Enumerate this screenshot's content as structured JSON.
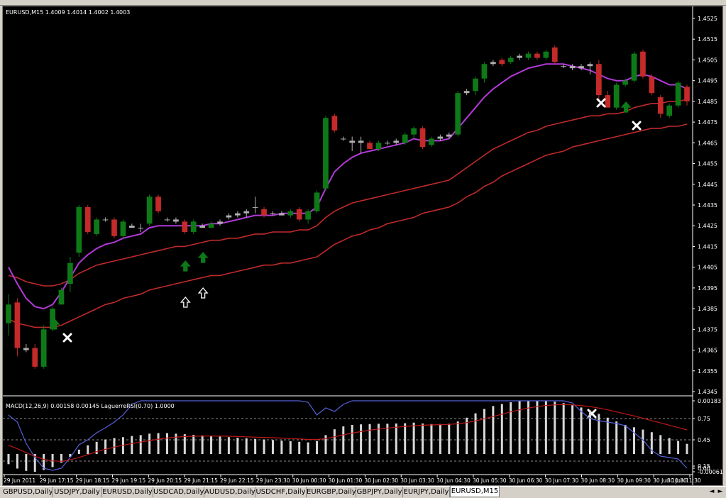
{
  "window": {
    "symbol_header": "EURUSD,M15  1.4009 1.4014 1.4002 1.4003",
    "indicator_header": "MACD(12,26,9) 0.00158 0.00145  LaguerreRSI(0.70) 1.0000"
  },
  "main_axis": {
    "labels": [
      "1.4525",
      "1.4515",
      "1.4505",
      "1.4495",
      "1.4485",
      "1.4475",
      "1.4465",
      "1.4455",
      "1.4445",
      "1.4435",
      "1.4425",
      "1.4415",
      "1.4405",
      "1.4395",
      "1.4385",
      "1.4375",
      "1.4365",
      "1.4355",
      "1.4345"
    ],
    "min": 1.4345,
    "max": 1.4525
  },
  "sub_axis": {
    "labels": [
      "0.00183",
      "0.75",
      "0.45",
      "0.00",
      "0.15",
      "-0.00061"
    ]
  },
  "time_axis": {
    "labels": [
      "29 Jun 2011",
      "29 Jun 17:15",
      "29 Jun 18:15",
      "29 Jun 19:15",
      "29 Jun 20:15",
      "29 Jun 21:15",
      "29 Jun 22:15",
      "29 Jun 23:30",
      "30 Jun 00:30",
      "30 Jun 01:30",
      "30 Jun 02:30",
      "30 Jun 03:30",
      "30 Jun 04:30",
      "30 Jun 05:30",
      "30 Jun 06:30",
      "30 Jun 07:30",
      "30 Jun 08:30",
      "30 Jun 09:30",
      "30 Jun 10:30",
      "30 Jun 11:30"
    ]
  },
  "colors": {
    "bull": "#0d7a17",
    "bear": "#c42a2a",
    "doji": "#b0b0b0",
    "ma_fast": "#b23ad8",
    "ma_slow": "#c02a2a",
    "macd_hist": "#d8d8d8",
    "rsi": "#5560d8",
    "signal": "#c01818",
    "arrow_up": "#0d7a17"
  },
  "tabs": [
    "GBPUSD,Daily",
    "USDJPY,Daily",
    "EURUSD,Daily",
    "USDCAD,Daily",
    "AUDUSD,Daily",
    "USDCHF,Daily",
    "EURGBP,Daily",
    "GBPJPY,Daily",
    "EURJPY,Daily",
    "EURUSD,M15"
  ],
  "active_tab": "EURUSD,M15",
  "nav": {
    "left": "◄",
    "right": "►"
  },
  "chart_data": {
    "type": "candlestick",
    "title": "EURUSD,M15",
    "candles": [
      {
        "o": 1.4378,
        "h": 1.4392,
        "l": 1.4372,
        "c": 1.4387
      },
      {
        "o": 1.4388,
        "h": 1.439,
        "l": 1.4362,
        "c": 1.4366
      },
      {
        "o": 1.4366,
        "h": 1.4368,
        "l": 1.4364,
        "c": 1.4365
      },
      {
        "o": 1.4366,
        "h": 1.4368,
        "l": 1.4356,
        "c": 1.4357
      },
      {
        "o": 1.4357,
        "h": 1.4377,
        "l": 1.4356,
        "c": 1.4375
      },
      {
        "o": 1.4375,
        "h": 1.4386,
        "l": 1.4374,
        "c": 1.4385
      },
      {
        "o": 1.4387,
        "h": 1.4395,
        "l": 1.4387,
        "c": 1.4394
      },
      {
        "o": 1.4397,
        "h": 1.441,
        "l": 1.4393,
        "c": 1.4407
      },
      {
        "o": 1.4412,
        "h": 1.4435,
        "l": 1.441,
        "c": 1.4434
      },
      {
        "o": 1.4434,
        "h": 1.4435,
        "l": 1.4421,
        "c": 1.4422
      },
      {
        "o": 1.4421,
        "h": 1.4429,
        "l": 1.442,
        "c": 1.4428
      },
      {
        "o": 1.4428,
        "h": 1.4429,
        "l": 1.4427,
        "c": 1.4428
      },
      {
        "o": 1.4428,
        "h": 1.4429,
        "l": 1.4419,
        "c": 1.442
      },
      {
        "o": 1.442,
        "h": 1.4428,
        "l": 1.4419,
        "c": 1.4427
      },
      {
        "o": 1.4425,
        "h": 1.4426,
        "l": 1.4424,
        "c": 1.4424
      },
      {
        "o": 1.4424,
        "h": 1.4426,
        "l": 1.4422,
        "c": 1.4424
      },
      {
        "o": 1.4426,
        "h": 1.444,
        "l": 1.4425,
        "c": 1.4439
      },
      {
        "o": 1.4439,
        "h": 1.444,
        "l": 1.4431,
        "c": 1.4432
      },
      {
        "o": 1.4428,
        "h": 1.4429,
        "l": 1.4427,
        "c": 1.4428
      },
      {
        "o": 1.4428,
        "h": 1.4429,
        "l": 1.4426,
        "c": 1.4427
      },
      {
        "o": 1.4427,
        "h": 1.4428,
        "l": 1.4421,
        "c": 1.4422
      },
      {
        "o": 1.4422,
        "h": 1.4428,
        "l": 1.4421,
        "c": 1.4427
      },
      {
        "o": 1.4425,
        "h": 1.4426,
        "l": 1.4424,
        "c": 1.4424
      },
      {
        "o": 1.4424,
        "h": 1.4427,
        "l": 1.4424,
        "c": 1.4426
      },
      {
        "o": 1.4426,
        "h": 1.4428,
        "l": 1.4425,
        "c": 1.4427
      },
      {
        "o": 1.4429,
        "h": 1.4431,
        "l": 1.4428,
        "c": 1.443
      },
      {
        "o": 1.443,
        "h": 1.4432,
        "l": 1.4429,
        "c": 1.4431
      },
      {
        "o": 1.4431,
        "h": 1.4433,
        "l": 1.4429,
        "c": 1.4432
      },
      {
        "o": 1.4434,
        "h": 1.4439,
        "l": 1.4431,
        "c": 1.4434
      },
      {
        "o": 1.4433,
        "h": 1.4434,
        "l": 1.4429,
        "c": 1.443
      },
      {
        "o": 1.4431,
        "h": 1.4432,
        "l": 1.443,
        "c": 1.4431
      },
      {
        "o": 1.4431,
        "h": 1.4432,
        "l": 1.443,
        "c": 1.443
      },
      {
        "o": 1.443,
        "h": 1.4433,
        "l": 1.4429,
        "c": 1.4432
      },
      {
        "o": 1.4433,
        "h": 1.4434,
        "l": 1.4427,
        "c": 1.4428
      },
      {
        "o": 1.4428,
        "h": 1.4433,
        "l": 1.4426,
        "c": 1.4432
      },
      {
        "o": 1.4432,
        "h": 1.4442,
        "l": 1.4431,
        "c": 1.4441
      },
      {
        "o": 1.4443,
        "h": 1.4478,
        "l": 1.4442,
        "c": 1.4477
      },
      {
        "o": 1.4478,
        "h": 1.4479,
        "l": 1.447,
        "c": 1.4471
      },
      {
        "o": 1.4467,
        "h": 1.4468,
        "l": 1.4466,
        "c": 1.4467
      },
      {
        "o": 1.4466,
        "h": 1.4468,
        "l": 1.4461,
        "c": 1.4465
      },
      {
        "o": 1.4466,
        "h": 1.4468,
        "l": 1.446,
        "c": 1.4465
      },
      {
        "o": 1.4465,
        "h": 1.4466,
        "l": 1.4462,
        "c": 1.4462
      },
      {
        "o": 1.4462,
        "h": 1.4466,
        "l": 1.4461,
        "c": 1.4465
      },
      {
        "o": 1.4465,
        "h": 1.4466,
        "l": 1.4464,
        "c": 1.4465
      },
      {
        "o": 1.4465,
        "h": 1.4467,
        "l": 1.4464,
        "c": 1.4466
      },
      {
        "o": 1.4465,
        "h": 1.447,
        "l": 1.4464,
        "c": 1.4469
      },
      {
        "o": 1.4469,
        "h": 1.4473,
        "l": 1.4467,
        "c": 1.4472
      },
      {
        "o": 1.4472,
        "h": 1.4473,
        "l": 1.4462,
        "c": 1.4463
      },
      {
        "o": 1.4464,
        "h": 1.4468,
        "l": 1.4463,
        "c": 1.4467
      },
      {
        "o": 1.4467,
        "h": 1.4469,
        "l": 1.4466,
        "c": 1.4468
      },
      {
        "o": 1.4468,
        "h": 1.447,
        "l": 1.4467,
        "c": 1.4469
      },
      {
        "o": 1.4469,
        "h": 1.449,
        "l": 1.4468,
        "c": 1.4489
      },
      {
        "o": 1.4489,
        "h": 1.4491,
        "l": 1.4488,
        "c": 1.449
      },
      {
        "o": 1.449,
        "h": 1.4497,
        "l": 1.4488,
        "c": 1.4496
      },
      {
        "o": 1.4496,
        "h": 1.4504,
        "l": 1.4494,
        "c": 1.4503
      },
      {
        "o": 1.4503,
        "h": 1.4505,
        "l": 1.4502,
        "c": 1.4504
      },
      {
        "o": 1.4505,
        "h": 1.4506,
        "l": 1.4502,
        "c": 1.4503
      },
      {
        "o": 1.4504,
        "h": 1.4507,
        "l": 1.4503,
        "c": 1.4506
      },
      {
        "o": 1.4506,
        "h": 1.4508,
        "l": 1.4505,
        "c": 1.4507
      },
      {
        "o": 1.4506,
        "h": 1.4509,
        "l": 1.4505,
        "c": 1.4508
      },
      {
        "o": 1.4508,
        "h": 1.4509,
        "l": 1.4505,
        "c": 1.4506
      },
      {
        "o": 1.4506,
        "h": 1.451,
        "l": 1.4505,
        "c": 1.4509
      },
      {
        "o": 1.4511,
        "h": 1.4512,
        "l": 1.4503,
        "c": 1.4504
      },
      {
        "o": 1.4502,
        "h": 1.4503,
        "l": 1.4501,
        "c": 1.4502
      },
      {
        "o": 1.4502,
        "h": 1.4503,
        "l": 1.45,
        "c": 1.4501
      },
      {
        "o": 1.4502,
        "h": 1.4503,
        "l": 1.45,
        "c": 1.4501
      },
      {
        "o": 1.4503,
        "h": 1.4504,
        "l": 1.4498,
        "c": 1.4502
      },
      {
        "o": 1.4503,
        "h": 1.4505,
        "l": 1.4486,
        "c": 1.4488
      },
      {
        "o": 1.4488,
        "h": 1.449,
        "l": 1.4482,
        "c": 1.4482
      },
      {
        "o": 1.4482,
        "h": 1.4494,
        "l": 1.4481,
        "c": 1.4493
      },
      {
        "o": 1.4493,
        "h": 1.4496,
        "l": 1.4492,
        "c": 1.4495
      },
      {
        "o": 1.4495,
        "h": 1.4509,
        "l": 1.4494,
        "c": 1.4508
      },
      {
        "o": 1.4509,
        "h": 1.451,
        "l": 1.4496,
        "c": 1.4497
      },
      {
        "o": 1.4497,
        "h": 1.4498,
        "l": 1.4488,
        "c": 1.4489
      },
      {
        "o": 1.4487,
        "h": 1.4488,
        "l": 1.4477,
        "c": 1.4479
      },
      {
        "o": 1.4478,
        "h": 1.4484,
        "l": 1.4477,
        "c": 1.4483
      },
      {
        "o": 1.4483,
        "h": 1.4495,
        "l": 1.4482,
        "c": 1.4494
      },
      {
        "o": 1.4492,
        "h": 1.4493,
        "l": 1.4483,
        "c": 1.4485
      }
    ],
    "ma_fast": [
      1.4405,
      1.4397,
      1.439,
      1.4386,
      1.4385,
      1.4387,
      1.4393,
      1.44,
      1.4407,
      1.4411,
      1.4414,
      1.4416,
      1.4417,
      1.4419,
      1.442,
      1.4421,
      1.4424,
      1.4425,
      1.4425,
      1.4425,
      1.4425,
      1.4425,
      1.4425,
      1.4426,
      1.4426,
      1.4427,
      1.4428,
      1.4429,
      1.443,
      1.443,
      1.443,
      1.4431,
      1.4431,
      1.4431,
      1.4431,
      1.4434,
      1.4443,
      1.4451,
      1.4455,
      1.4458,
      1.446,
      1.4461,
      1.4462,
      1.4463,
      1.4464,
      1.4465,
      1.4467,
      1.4466,
      1.4466,
      1.4466,
      1.4467,
      1.4472,
      1.4477,
      1.4482,
      1.4487,
      1.4491,
      1.4494,
      1.4497,
      1.4499,
      1.4501,
      1.4502,
      1.4503,
      1.4503,
      1.4503,
      1.4502,
      1.4501,
      1.45,
      1.4498,
      1.4496,
      1.4495,
      1.4495,
      1.4497,
      1.4498,
      1.4497,
      1.4495,
      1.4493,
      1.4493,
      1.4491
    ],
    "ma_mid": [
      1.4401,
      1.44,
      1.4398,
      1.4397,
      1.4396,
      1.4396,
      1.4397,
      1.4399,
      1.4402,
      1.4404,
      1.4406,
      1.4407,
      1.4408,
      1.4409,
      1.441,
      1.4411,
      1.4412,
      1.4413,
      1.4414,
      1.4415,
      1.4415,
      1.4416,
      1.4417,
      1.4418,
      1.4418,
      1.4419,
      1.4419,
      1.442,
      1.4421,
      1.4421,
      1.4422,
      1.4422,
      1.4422,
      1.4423,
      1.4423,
      1.4425,
      1.4429,
      1.4432,
      1.4434,
      1.4436,
      1.4437,
      1.4438,
      1.4439,
      1.444,
      1.4441,
      1.4442,
      1.4443,
      1.4444,
      1.4445,
      1.4446,
      1.4447,
      1.445,
      1.4453,
      1.4456,
      1.4459,
      1.4462,
      1.4464,
      1.4466,
      1.4468,
      1.447,
      1.4471,
      1.4473,
      1.4474,
      1.4475,
      1.4476,
      1.4477,
      1.4478,
      1.4478,
      1.4479,
      1.4479,
      1.448,
      1.4482,
      1.4483,
      1.4484,
      1.4484,
      1.4485,
      1.4485,
      1.4486
    ],
    "ma_slow": [
      1.438,
      1.4378,
      1.4377,
      1.4376,
      1.4376,
      1.4376,
      1.4377,
      1.4379,
      1.4381,
      1.4383,
      1.4385,
      1.4387,
      1.4388,
      1.439,
      1.4391,
      1.4392,
      1.4394,
      1.4395,
      1.4396,
      1.4397,
      1.4398,
      1.4399,
      1.44,
      1.4401,
      1.4401,
      1.4402,
      1.4403,
      1.4404,
      1.4405,
      1.4406,
      1.4406,
      1.4407,
      1.4407,
      1.4408,
      1.4409,
      1.441,
      1.4413,
      1.4416,
      1.4418,
      1.442,
      1.4421,
      1.4423,
      1.4424,
      1.4426,
      1.4427,
      1.4428,
      1.4429,
      1.4431,
      1.4432,
      1.4433,
      1.4434,
      1.4436,
      1.4439,
      1.4441,
      1.4444,
      1.4446,
      1.4449,
      1.4451,
      1.4453,
      1.4455,
      1.4457,
      1.4459,
      1.446,
      1.4461,
      1.4463,
      1.4464,
      1.4465,
      1.4466,
      1.4467,
      1.4468,
      1.4469,
      1.447,
      1.4471,
      1.4472,
      1.4472,
      1.4473,
      1.4473,
      1.4474
    ],
    "arrows_up_filled": [
      5,
      20,
      22,
      70
    ],
    "arrows_up_hollow": [
      20,
      22
    ],
    "cross_marks": [
      {
        "i": 6,
        "p": 1.4369
      },
      {
        "i": 64,
        "p": 1.4483
      },
      {
        "i": 69,
        "p": 1.447
      }
    ],
    "macd_hist": [
      -0.00035,
      -0.0005,
      -0.00058,
      -0.00061,
      -0.00055,
      -0.00045,
      -0.0003,
      -0.0001,
      0.00015,
      0.0003,
      0.00042,
      0.0005,
      0.00055,
      0.00058,
      0.00062,
      0.00065,
      0.0007,
      0.00072,
      0.00072,
      0.0007,
      0.00068,
      0.00066,
      0.00064,
      0.00062,
      0.0006,
      0.00058,
      0.00056,
      0.00054,
      0.00052,
      0.0005,
      0.00048,
      0.00046,
      0.00044,
      0.00042,
      0.0004,
      0.00045,
      0.00065,
      0.00085,
      0.00095,
      0.001,
      0.00102,
      0.00103,
      0.00104,
      0.00104,
      0.00105,
      0.00106,
      0.00108,
      0.00105,
      0.00103,
      0.00103,
      0.00104,
      0.00112,
      0.00125,
      0.0014,
      0.00155,
      0.00165,
      0.00172,
      0.00178,
      0.00182,
      0.00183,
      0.00183,
      0.00182,
      0.0018,
      0.00175,
      0.00168,
      0.0016,
      0.0015,
      0.00138,
      0.00125,
      0.00112,
      0.001,
      0.00092,
      0.00084,
      0.00075,
      0.00065,
      0.00055,
      0.00045,
      0.00035
    ],
    "macd_signal": [
      0.0003,
      0.00018,
      5e-05,
      -8e-05,
      -0.00018,
      -0.00024,
      -0.00025,
      -0.0002,
      -0.00012,
      -2e-05,
      8e-05,
      0.00016,
      0.00024,
      0.0003,
      0.00036,
      0.00041,
      0.00046,
      0.00051,
      0.00055,
      0.00058,
      0.0006,
      0.00061,
      0.00062,
      0.00062,
      0.00062,
      0.00061,
      0.0006,
      0.00059,
      0.00058,
      0.00057,
      0.00056,
      0.00055,
      0.00053,
      0.00052,
      0.0005,
      0.0005,
      0.00053,
      0.00059,
      0.00066,
      0.00072,
      0.00077,
      0.00082,
      0.00086,
      0.00089,
      0.00092,
      0.00095,
      0.00097,
      0.00099,
      0.001,
      0.00101,
      0.00102,
      0.00104,
      0.00108,
      0.00114,
      0.00121,
      0.00129,
      0.00137,
      0.00145,
      0.00152,
      0.00158,
      0.00163,
      0.00167,
      0.00169,
      0.0017,
      0.00169,
      0.00167,
      0.00163,
      0.00158,
      0.00152,
      0.00145,
      0.00138,
      0.00131,
      0.00123,
      0.00115,
      0.00107,
      0.00099,
      0.00091,
      0.00083
    ],
    "laguerre_rsi": [
      0.8,
      0.7,
      0.4,
      0.2,
      0.05,
      0.02,
      0.05,
      0.2,
      0.38,
      0.45,
      0.55,
      0.62,
      0.7,
      0.8,
      0.95,
      1.0,
      1.0,
      1.0,
      1.0,
      1.0,
      1.0,
      1.0,
      1.0,
      1.0,
      1.0,
      1.0,
      1.0,
      1.0,
      1.0,
      1.0,
      1.0,
      1.0,
      1.0,
      1.0,
      0.98,
      0.8,
      0.9,
      0.85,
      0.95,
      1.0,
      1.0,
      1.0,
      1.0,
      1.0,
      1.0,
      1.0,
      1.0,
      1.0,
      1.0,
      1.0,
      1.0,
      1.0,
      1.0,
      1.0,
      1.0,
      1.0,
      1.0,
      1.0,
      1.0,
      1.0,
      1.0,
      1.0,
      1.0,
      1.0,
      0.97,
      0.85,
      0.75,
      0.72,
      0.7,
      0.68,
      0.65,
      0.55,
      0.45,
      0.3,
      0.22,
      0.2,
      0.18,
      0.05
    ]
  }
}
